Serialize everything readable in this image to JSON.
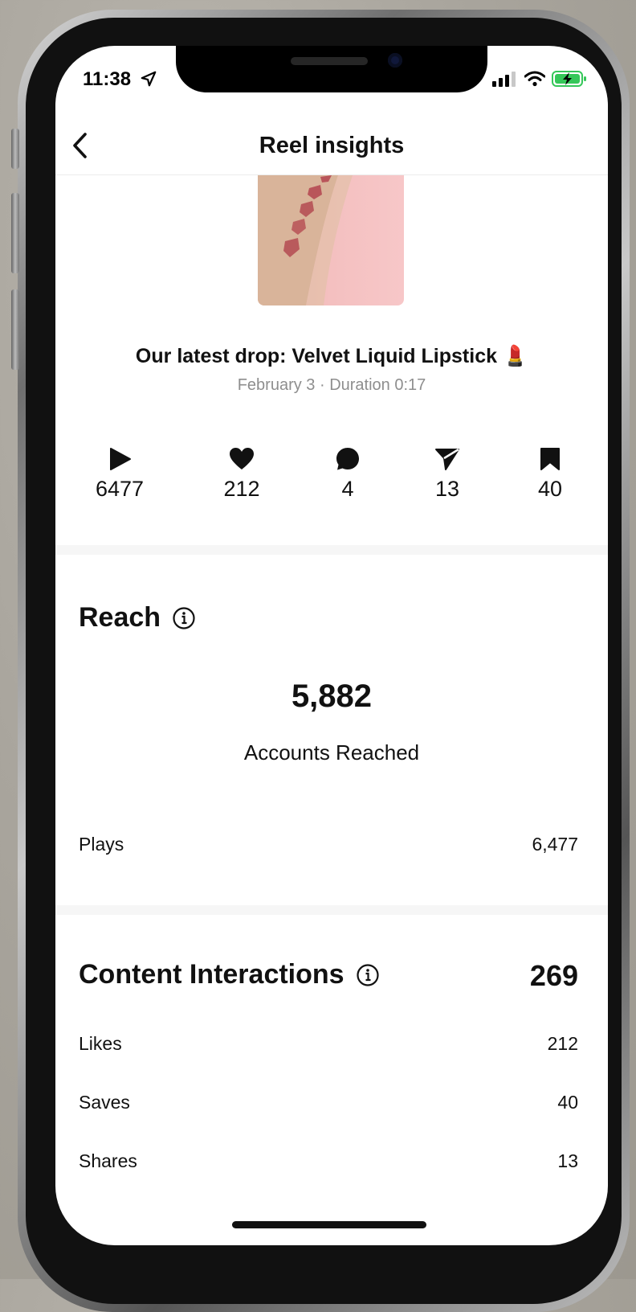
{
  "status_bar": {
    "time": "11:38"
  },
  "header": {
    "title": "Reel insights"
  },
  "reel": {
    "title": "Our latest drop: Velvet Liquid Lipstick 💄",
    "subtitle": "February 3 · Duration 0:17"
  },
  "stats": [
    {
      "icon": "play-icon",
      "value": "6477"
    },
    {
      "icon": "heart-icon",
      "value": "212"
    },
    {
      "icon": "comment-icon",
      "value": "4"
    },
    {
      "icon": "share-icon",
      "value": "13"
    },
    {
      "icon": "bookmark-icon",
      "value": "40"
    }
  ],
  "reach": {
    "heading": "Reach",
    "accounts_value": "5,882",
    "accounts_label": "Accounts Reached",
    "plays_label": "Plays",
    "plays_value": "6,477"
  },
  "interactions": {
    "heading": "Content Interactions",
    "total": "269",
    "rows": [
      {
        "label": "Likes",
        "value": "212"
      },
      {
        "label": "Saves",
        "value": "40"
      },
      {
        "label": "Shares",
        "value": "13"
      }
    ]
  },
  "colors": {
    "accent_text": "#111111",
    "muted_text": "#8e8e8e",
    "battery": "#35c759"
  }
}
